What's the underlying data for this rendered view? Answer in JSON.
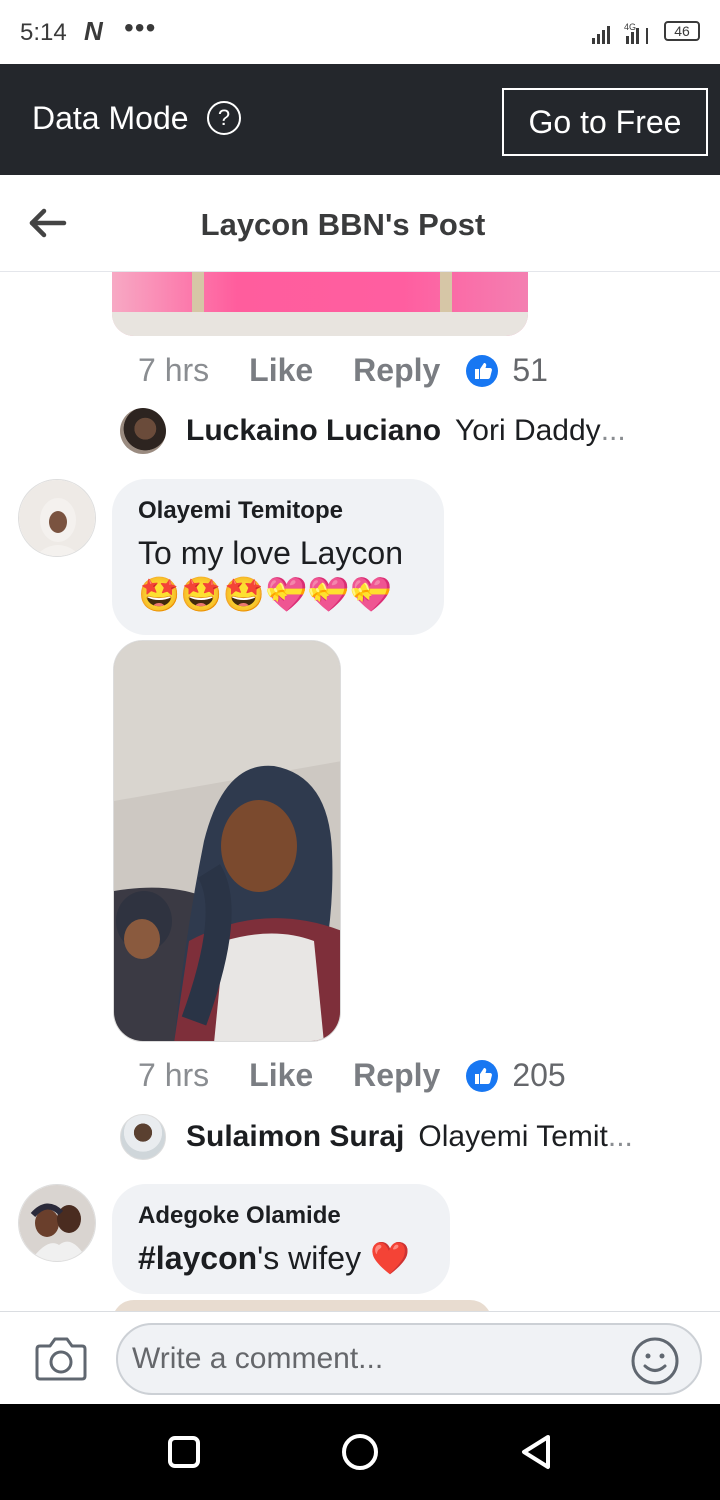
{
  "status_bar": {
    "time": "5:14",
    "network_letter": "N",
    "dots": "•••",
    "battery": "46"
  },
  "data_mode": {
    "label": "Data Mode",
    "help": "?",
    "button": "Go to Free"
  },
  "header": {
    "title": "Laycon BBN's Post"
  },
  "comments": [
    {
      "actions": {
        "time": "7 hrs",
        "like": "Like",
        "reply": "Reply",
        "likes": "51"
      },
      "reply_preview": {
        "name": "Luckaino Luciano",
        "text": "Yori Daddy",
        "ellipsis": "..."
      }
    },
    {
      "author": "Olayemi Temitope",
      "text": "To my love Laycon",
      "emojis": "🤩🤩🤩💝💝💝",
      "actions": {
        "time": "7 hrs",
        "like": "Like",
        "reply": "Reply",
        "likes": "205"
      },
      "reply_preview": {
        "name": "Sulaimon Suraj",
        "text": "Olayemi Temit",
        "ellipsis": "..."
      }
    },
    {
      "author": "Adegoke Olamide",
      "hashtag": "#laycon",
      "text_rest": "'s wifey",
      "emoji": "❤️"
    }
  ],
  "comment_bar": {
    "placeholder": "Write a comment..."
  },
  "colors": {
    "accent": "#1877f2",
    "data_bar": "#24272c",
    "bubble": "#f0f2f5"
  }
}
